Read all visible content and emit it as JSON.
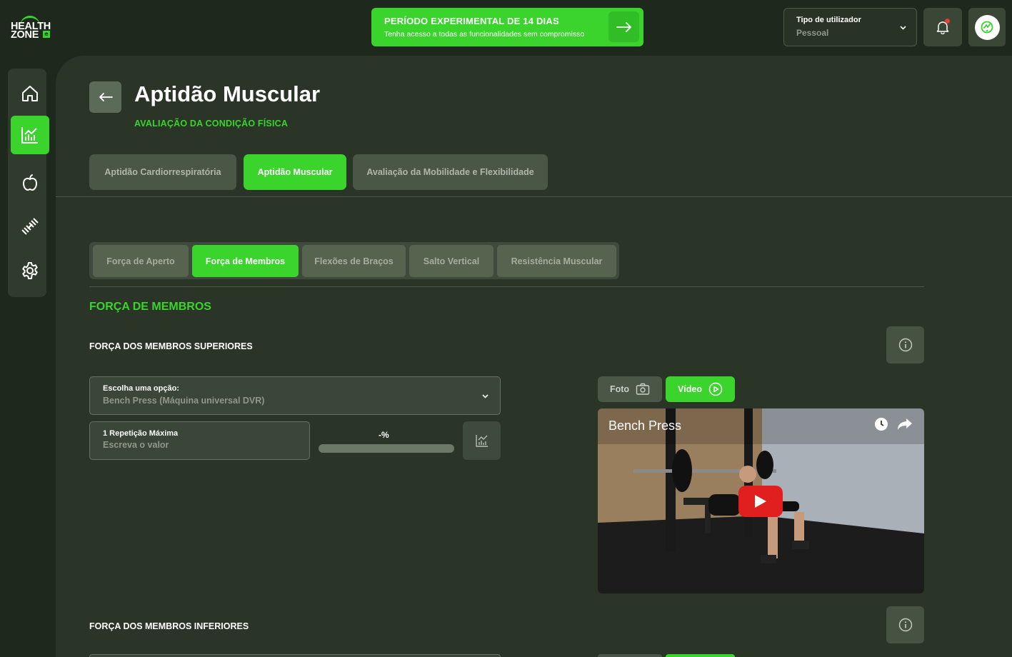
{
  "brand": {
    "logo_line1": "HEALTH",
    "logo_line2": "ZONE",
    "logo_badge": "e",
    "accent": "#3ad42d"
  },
  "trial_banner": {
    "title": "PERÍODO EXPERIMENTAL DE 14 DIAS",
    "subtitle": "Tenha acesso a todas as funcionalidades sem compromisso",
    "icon": "arrow-right-icon"
  },
  "header": {
    "user_type": {
      "label": "Tipo de utilizador",
      "value": "Pessoal"
    },
    "notification_icon": "bell-icon",
    "notification_dot_color": "#e53e2c",
    "profile_icon": "avatar-icon"
  },
  "sidebar": {
    "items": [
      {
        "icon": "home-icon",
        "active": false
      },
      {
        "icon": "chart-icon",
        "active": true
      },
      {
        "icon": "apple-icon",
        "active": false
      },
      {
        "icon": "dumbbell-icon",
        "active": false
      },
      {
        "icon": "gear-icon",
        "active": false
      }
    ]
  },
  "page": {
    "title": "Aptidão Muscular",
    "subtitle": "AVALIAÇÃO DA CONDIÇÃO FÍSICA"
  },
  "tabs": [
    {
      "label": "Aptidão Cardiorrespiratória",
      "active": false
    },
    {
      "label": "Aptidão Muscular",
      "active": true
    },
    {
      "label": "Avaliação da Mobilidade e Flexibilidade",
      "active": false
    }
  ],
  "subtabs": [
    {
      "label": "Força de Aperto",
      "active": false
    },
    {
      "label": "Força de Membros",
      "active": true
    },
    {
      "label": "Flexões de Braços",
      "active": false
    },
    {
      "label": "Salto Vertical",
      "active": false
    },
    {
      "label": "Resistência Muscular",
      "active": false
    }
  ],
  "section": {
    "title": "FORÇA DE MEMBROS",
    "upper": {
      "title": "FORÇA DOS MEMBROS SUPERIORES",
      "select_label": "Escolha uma opção:",
      "select_value": "Bench Press (Máquina universal DVR)",
      "rm_label": "1 Repetição Máxima",
      "rm_placeholder": "Escreva o valor",
      "percent_text": "-%",
      "progress": 0,
      "media_tabs": {
        "photo": "Foto",
        "video": "Vídeo"
      },
      "video_title": "Bench Press"
    },
    "lower": {
      "title": "FORÇA DOS MEMBROS INFERIORES"
    }
  }
}
